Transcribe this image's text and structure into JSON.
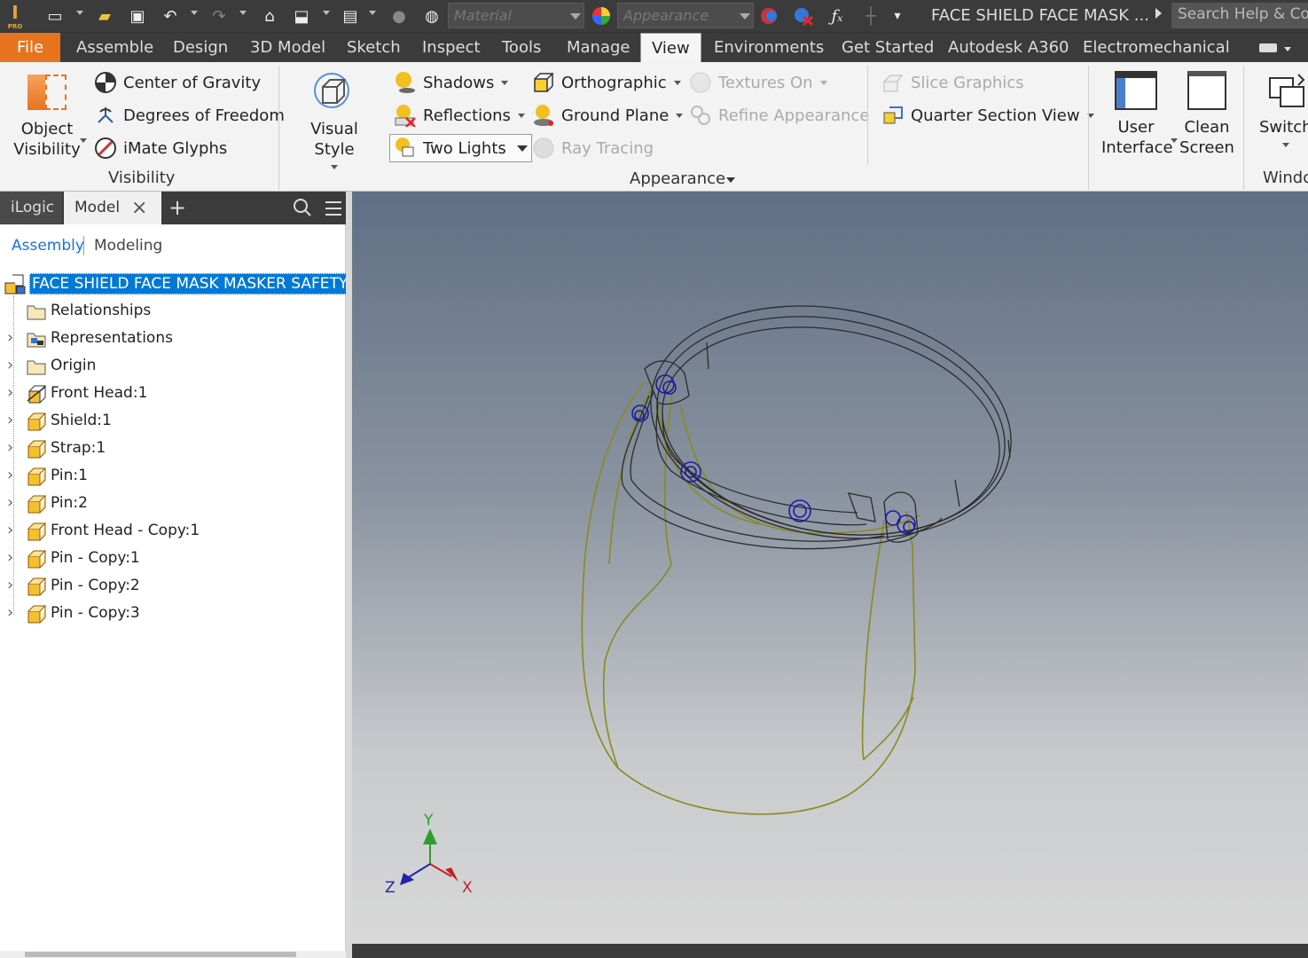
{
  "app": {
    "logo_label": "PRO",
    "title": "FACE SHIELD FACE MASK ...",
    "search_placeholder": "Search Help & Co"
  },
  "qat": {
    "material_placeholder": "Material",
    "appearance_placeholder": "Appearance"
  },
  "tabs": [
    {
      "label": "File"
    },
    {
      "label": "Assemble"
    },
    {
      "label": "Design"
    },
    {
      "label": "3D Model"
    },
    {
      "label": "Sketch"
    },
    {
      "label": "Inspect"
    },
    {
      "label": "Tools"
    },
    {
      "label": "Manage"
    },
    {
      "label": "View"
    },
    {
      "label": "Environments"
    },
    {
      "label": "Get Started"
    },
    {
      "label": "Autodesk A360"
    },
    {
      "label": "Electromechanical"
    }
  ],
  "ribbon": {
    "visibility": {
      "object_visibility": [
        "Object",
        "Visibility"
      ],
      "center_of_gravity": "Center of Gravity",
      "degrees_of_freedom": "Degrees of Freedom",
      "imate_glyphs": "iMate Glyphs",
      "panel_label": "Visibility"
    },
    "appearance": {
      "visual_style": "Visual Style",
      "shadows": "Shadows",
      "reflections": "Reflections",
      "two_lights": "Two Lights",
      "orthographic": "Orthographic",
      "ground_plane": "Ground Plane",
      "ray_tracing": "Ray Tracing",
      "textures_on": "Textures On",
      "refine_appearance": "Refine Appearance",
      "slice_graphics": "Slice Graphics",
      "quarter_section_view": "Quarter Section View",
      "panel_label": "Appearance"
    },
    "windows": {
      "user_interface": [
        "User",
        "Interface"
      ],
      "clean_screen": [
        "Clean",
        "Screen"
      ],
      "switch": "Switch",
      "panel_label": "Windo"
    }
  },
  "browser": {
    "tabs": [
      "iLogic",
      "Model"
    ],
    "subtabs": [
      "Assembly",
      "Modeling"
    ],
    "root": "FACE SHIELD FACE MASK MASKER SAFETY.",
    "nodes": [
      {
        "label": "Relationships",
        "icon": "folder-icon"
      },
      {
        "label": "Representations",
        "icon": "representations-icon"
      },
      {
        "label": "Origin",
        "icon": "folder-icon"
      },
      {
        "label": "Front Head:1",
        "icon": "grounded-part-icon"
      },
      {
        "label": "Shield:1",
        "icon": "part-icon"
      },
      {
        "label": "Strap:1",
        "icon": "part-icon"
      },
      {
        "label": "Pin:1",
        "icon": "part-icon"
      },
      {
        "label": "Pin:2",
        "icon": "part-icon"
      },
      {
        "label": "Front Head - Copy:1",
        "icon": "part-icon"
      },
      {
        "label": "Pin - Copy:1",
        "icon": "part-icon"
      },
      {
        "label": "Pin - Copy:2",
        "icon": "part-icon"
      },
      {
        "label": "Pin - Copy:3",
        "icon": "part-icon"
      }
    ]
  },
  "viewport": {
    "axis_labels": {
      "x": "X",
      "y": "Y",
      "z": "Z"
    }
  },
  "colors": {
    "accent": "#e8731f",
    "selection": "#0078d7",
    "link": "#1a73d9",
    "shield_wire": "#8a8a1e",
    "pin_wire": "#1a1aa8"
  }
}
